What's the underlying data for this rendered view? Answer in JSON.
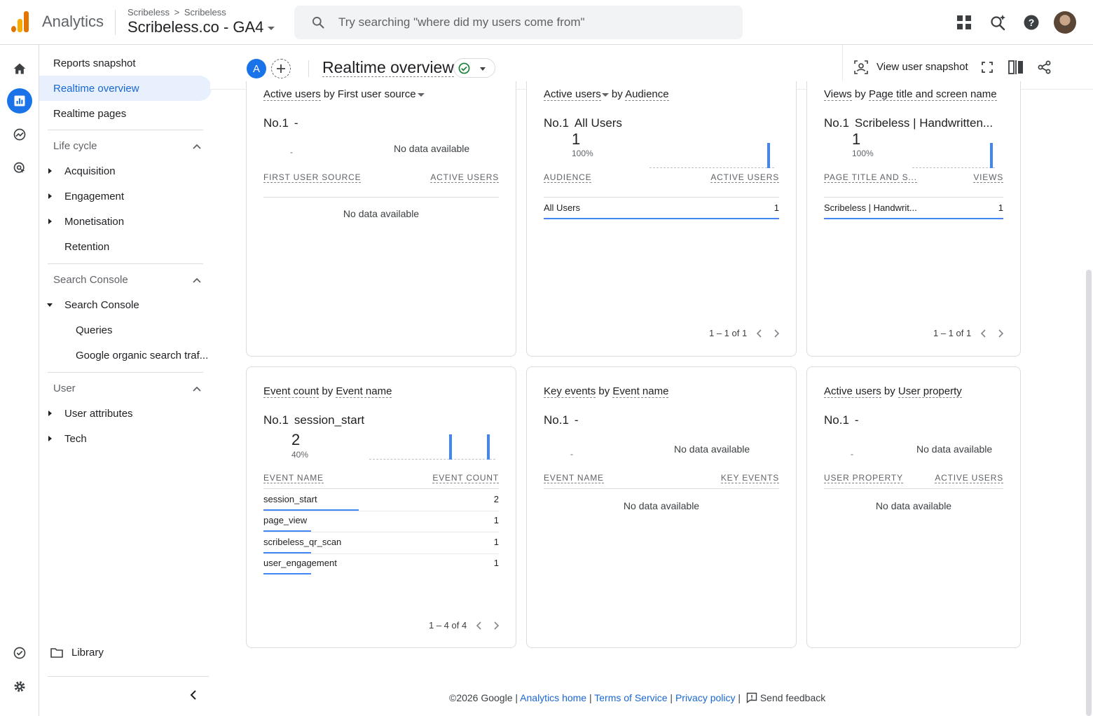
{
  "header": {
    "app_name": "Analytics",
    "breadcrumb": [
      "Scribeless",
      "Scribeless"
    ],
    "breadcrumb_sep": ">",
    "property_name": "Scribeless.co - GA4",
    "search_placeholder": "Try searching \"where did my users come from\"",
    "icons": [
      "apps-icon",
      "search-insights-icon",
      "help-icon",
      "account-avatar"
    ]
  },
  "sidenav": {
    "items": [
      {
        "label": "Reports snapshot"
      },
      {
        "label": "Realtime overview",
        "active": true
      },
      {
        "label": "Realtime pages"
      }
    ],
    "lifecycle": {
      "heading": "Life cycle",
      "items": [
        "Acquisition",
        "Engagement",
        "Monetisation",
        "Retention"
      ]
    },
    "search_console": {
      "heading": "Search Console",
      "group": "Search Console",
      "items": [
        "Queries",
        "Google organic search traf..."
      ]
    },
    "user": {
      "heading": "User",
      "items": [
        "User attributes",
        "Tech"
      ]
    },
    "library": "Library"
  },
  "page": {
    "avatar_letter": "A",
    "title": "Realtime overview",
    "view_snapshot": "View user snapshot"
  },
  "cards": {
    "source": {
      "title_a": "Active users",
      "title_b": " by ",
      "title_c": "First user source",
      "rank": "No.1",
      "top": "-",
      "small_dash": "-",
      "no_data_top": "No data available",
      "col1": "FIRST USER SOURCE",
      "col2": "ACTIVE USERS",
      "no_data": "No data available"
    },
    "audience": {
      "title_a": "Active users",
      "title_b": " by ",
      "title_c": "Audience",
      "rank": "No.1",
      "top": "All Users",
      "value": "1",
      "pct": "100%",
      "col1": "AUDIENCE",
      "col2": "ACTIVE USERS",
      "rows": [
        {
          "label": "All Users",
          "value": "1",
          "share": 1.0
        }
      ],
      "pager": "1 – 1 of 1"
    },
    "views": {
      "title_a": "Views",
      "title_b": " by ",
      "title_c": "Page title and screen name",
      "rank": "No.1",
      "top": "Scribeless | Handwritten...",
      "value": "1",
      "pct": "100%",
      "col1": "PAGE TITLE AND S...",
      "col2": "VIEWS",
      "rows": [
        {
          "label": "Scribeless | Handwrit...",
          "value": "1",
          "share": 1.0
        }
      ],
      "pager": "1 – 1 of 1"
    },
    "events": {
      "title_a": "Event count",
      "title_b": " by ",
      "title_c": "Event name",
      "rank": "No.1",
      "top": "session_start",
      "value": "2",
      "pct": "40%",
      "col1": "EVENT NAME",
      "col2": "EVENT COUNT",
      "rows": [
        {
          "label": "session_start",
          "value": "2",
          "share": 1.0
        },
        {
          "label": "page_view",
          "value": "1",
          "share": 0.5
        },
        {
          "label": "scribeless_qr_scan",
          "value": "1",
          "share": 0.5
        },
        {
          "label": "user_engagement",
          "value": "1",
          "share": 0.5
        }
      ],
      "pager": "1 – 4 of 4"
    },
    "key_events": {
      "title_a": "Key events",
      "title_b": " by ",
      "title_c": "Event name",
      "rank": "No.1",
      "top": "-",
      "small_dash": "-",
      "no_data_top": "No data available",
      "col1": "EVENT NAME",
      "col2": "KEY EVENTS",
      "no_data": "No data available"
    },
    "user_property": {
      "title_a": "Active users",
      "title_b": " by ",
      "title_c": "User property",
      "rank": "No.1",
      "top": "-",
      "small_dash": "-",
      "no_data_top": "No data available",
      "col1": "USER PROPERTY",
      "col2": "ACTIVE USERS",
      "no_data": "No data available"
    }
  },
  "footer": {
    "copyright": "©2026 Google",
    "sep": "|",
    "links": [
      "Analytics home",
      "Terms of Service",
      "Privacy policy"
    ],
    "feedback": "Send feedback"
  },
  "colors": {
    "accent": "#1a73e8",
    "bar": "#4285f4",
    "active_nav_bg": "#e8f0fe",
    "logo_orange": "#e37400",
    "logo_yellow": "#f9ab00"
  }
}
